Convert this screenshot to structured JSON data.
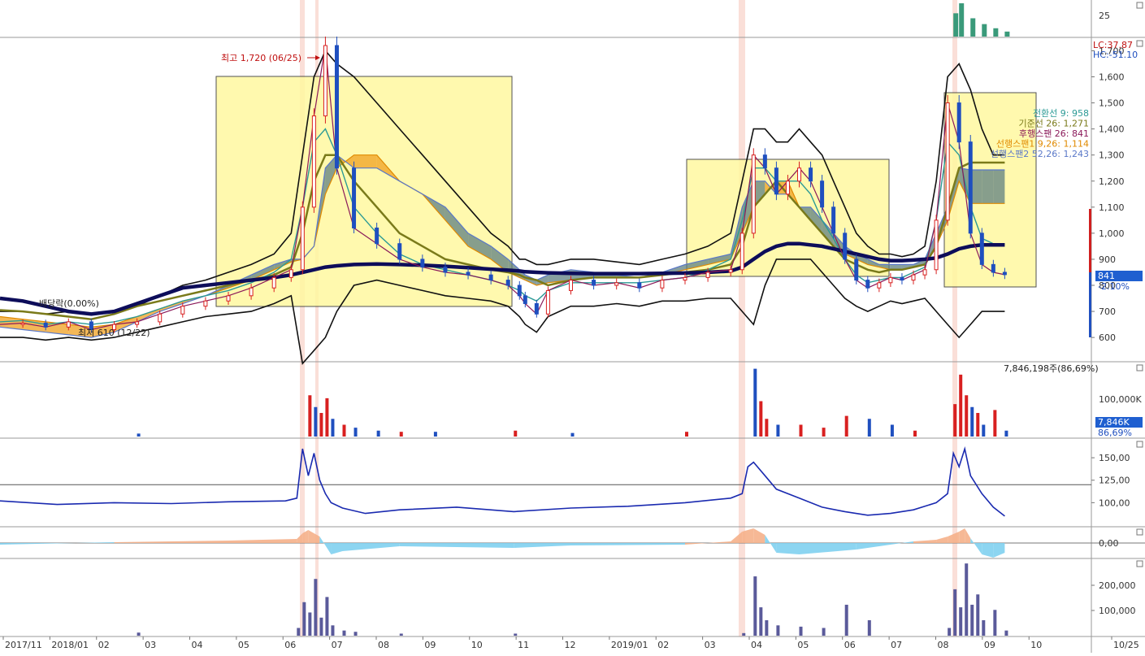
{
  "chart_data": {
    "type": "line",
    "x_ticks": [
      "2017/11",
      "2018/01",
      "02",
      "03",
      "04",
      "05",
      "06",
      "07",
      "08",
      "09",
      "10",
      "11",
      "12",
      "2019/01",
      "02",
      "03",
      "04",
      "05",
      "06",
      "07",
      "08",
      "09",
      "10",
      "10/25"
    ],
    "top_panel": {
      "axis_label": "25",
      "x": [
        0.835,
        0.84,
        0.85,
        0.86,
        0.87,
        0.88
      ],
      "values": [
        28,
        40,
        22,
        15,
        10,
        6
      ]
    },
    "price_panel": {
      "y_ticks": [
        1700,
        1600,
        1500,
        1400,
        1300,
        1200,
        1100,
        1000,
        900,
        800,
        700,
        600
      ],
      "ylim": [
        510,
        1745
      ],
      "lc_label": "LC:37.87",
      "hc_label": "HC:-51.10",
      "current_price_label": "841",
      "current_change_label": "-2.10%",
      "high_label": "최고 1,720 (06/25)",
      "low_label": "최저 610 (12/22)",
      "dividend_label": "배당락(0.00%)",
      "legend": [
        {
          "text": "전환선 9: 958",
          "color": "#2b9a95"
        },
        {
          "text": "기준선 26: 1,271",
          "color": "#7a7a1a"
        },
        {
          "text": "후행스팬 26: 841",
          "color": "#8b1a5a"
        },
        {
          "text": "선행스팬1 9,26: 1,114",
          "color": "#e08a00"
        },
        {
          "text": "선행스팬2 52,26: 1,243",
          "color": "#5a78c8"
        }
      ],
      "x": [
        0.0,
        0.02,
        0.04,
        0.06,
        0.08,
        0.1,
        0.12,
        0.14,
        0.16,
        0.18,
        0.2,
        0.22,
        0.24,
        0.255,
        0.265,
        0.275,
        0.285,
        0.295,
        0.31,
        0.33,
        0.35,
        0.37,
        0.39,
        0.41,
        0.43,
        0.445,
        0.455,
        0.46,
        0.47,
        0.48,
        0.5,
        0.52,
        0.54,
        0.56,
        0.58,
        0.6,
        0.62,
        0.64,
        0.65,
        0.66,
        0.67,
        0.68,
        0.69,
        0.7,
        0.71,
        0.72,
        0.73,
        0.74,
        0.75,
        0.76,
        0.77,
        0.78,
        0.79,
        0.8,
        0.81,
        0.82,
        0.83,
        0.84,
        0.85,
        0.86,
        0.87,
        0.88
      ],
      "close": [
        650,
        655,
        640,
        660,
        630,
        650,
        660,
        690,
        720,
        740,
        760,
        790,
        830,
        860,
        1100,
        1450,
        1720,
        1250,
        1020,
        960,
        900,
        870,
        850,
        840,
        820,
        800,
        760,
        730,
        690,
        780,
        820,
        800,
        810,
        790,
        820,
        830,
        850,
        860,
        1000,
        1300,
        1250,
        1150,
        1200,
        1250,
        1200,
        1100,
        1000,
        900,
        820,
        790,
        810,
        830,
        820,
        840,
        860,
        1050,
        1500,
        1350,
        1000,
        880,
        850,
        841
      ],
      "kijun": [
        705,
        700,
        690,
        680,
        670,
        690,
        720,
        740,
        760,
        780,
        800,
        820,
        840,
        870,
        1000,
        1200,
        1300,
        1300,
        1200,
        1100,
        1000,
        950,
        900,
        880,
        860,
        850,
        840,
        830,
        820,
        800,
        820,
        830,
        830,
        830,
        840,
        850,
        860,
        880,
        950,
        1100,
        1150,
        1200,
        1150,
        1100,
        1050,
        1000,
        950,
        900,
        880,
        860,
        850,
        860,
        860,
        870,
        880,
        950,
        1100,
        1250,
        1271,
        1271,
        1271,
        1271
      ],
      "tenkan": [
        660,
        665,
        650,
        660,
        650,
        660,
        680,
        710,
        740,
        760,
        780,
        810,
        850,
        900,
        1100,
        1350,
        1400,
        1300,
        1100,
        1000,
        920,
        880,
        860,
        840,
        820,
        800,
        780,
        760,
        740,
        780,
        810,
        810,
        810,
        810,
        820,
        830,
        860,
        900,
        1050,
        1250,
        1250,
        1200,
        1200,
        1200,
        1150,
        1050,
        980,
        900,
        840,
        810,
        820,
        830,
        830,
        850,
        870,
        1050,
        1350,
        1300,
        1100,
        980,
        960,
        958
      ],
      "ma_long": [
        750,
        740,
        720,
        700,
        690,
        700,
        730,
        760,
        790,
        800,
        810,
        820,
        830,
        840,
        850,
        860,
        870,
        875,
        880,
        882,
        880,
        877,
        873,
        868,
        862,
        858,
        855,
        852,
        850,
        848,
        846,
        845,
        845,
        845,
        846,
        847,
        850,
        855,
        870,
        900,
        930,
        950,
        960,
        960,
        955,
        950,
        940,
        930,
        920,
        910,
        900,
        895,
        895,
        897,
        900,
        905,
        920,
        940,
        950,
        955,
        955,
        955
      ],
      "span2": [
        640,
        630,
        620,
        610,
        600,
        620,
        660,
        700,
        730,
        760,
        800,
        840,
        880,
        900,
        900,
        950,
        1250,
        1300,
        1250,
        1250,
        1200,
        1150,
        1100,
        1000,
        950,
        900,
        860,
        840,
        820,
        840,
        860,
        850,
        840,
        830,
        850,
        880,
        900,
        920,
        1100,
        1200,
        1200,
        1150,
        1150,
        1100,
        1100,
        1050,
        1000,
        950,
        920,
        900,
        880,
        880,
        880,
        880,
        900,
        1000,
        1100,
        1250,
        1243,
        1243,
        1243,
        1243
      ],
      "span1": [
        680,
        670,
        660,
        650,
        640,
        650,
        680,
        710,
        740,
        760,
        790,
        820,
        860,
        890,
        900,
        950,
        1150,
        1250,
        1300,
        1300,
        1200,
        1150,
        1050,
        950,
        900,
        850,
        830,
        820,
        800,
        810,
        820,
        830,
        830,
        830,
        840,
        860,
        880,
        900,
        1000,
        1100,
        1150,
        1200,
        1200,
        1100,
        1050,
        1000,
        950,
        920,
        900,
        880,
        870,
        860,
        860,
        870,
        880,
        950,
        1050,
        1200,
        1114,
        1114,
        1114,
        1114
      ],
      "boll_upper": [
        700,
        700,
        690,
        700,
        690,
        700,
        720,
        760,
        800,
        820,
        850,
        880,
        920,
        1000,
        1300,
        1600,
        1700,
        1650,
        1600,
        1500,
        1400,
        1300,
        1200,
        1100,
        1000,
        950,
        900,
        900,
        880,
        880,
        900,
        900,
        890,
        880,
        900,
        920,
        950,
        1000,
        1200,
        1400,
        1400,
        1350,
        1350,
        1400,
        1350,
        1300,
        1200,
        1100,
        1000,
        950,
        920,
        920,
        910,
        920,
        950,
        1200,
        1600,
        1650,
        1550,
        1400,
        1300,
        1300
      ],
      "boll_lower": [
        600,
        600,
        590,
        600,
        590,
        600,
        620,
        640,
        660,
        680,
        690,
        700,
        730,
        760,
        500,
        550,
        600,
        700,
        800,
        820,
        800,
        780,
        760,
        750,
        740,
        720,
        680,
        650,
        620,
        680,
        720,
        720,
        730,
        720,
        740,
        740,
        750,
        750,
        700,
        650,
        800,
        900,
        900,
        900,
        900,
        850,
        800,
        750,
        720,
        700,
        720,
        740,
        730,
        740,
        750,
        700,
        650,
        600,
        650,
        700,
        700,
        700
      ]
    },
    "volume_panel": {
      "max_label": "7,846,198주(86,69%)",
      "y_ticks": [
        "100,000K"
      ],
      "current_label": "7,846K",
      "current_pct_label": "86,69%",
      "x": [
        0.12,
        0.27,
        0.275,
        0.28,
        0.285,
        0.29,
        0.3,
        0.31,
        0.33,
        0.35,
        0.38,
        0.45,
        0.5,
        0.6,
        0.66,
        0.665,
        0.67,
        0.68,
        0.7,
        0.72,
        0.74,
        0.76,
        0.78,
        0.8,
        0.835,
        0.84,
        0.845,
        0.85,
        0.855,
        0.86,
        0.87,
        0.88
      ],
      "values": [
        5,
        70,
        50,
        40,
        65,
        30,
        20,
        15,
        10,
        8,
        8,
        10,
        6,
        8,
        115,
        60,
        30,
        20,
        20,
        15,
        35,
        30,
        20,
        10,
        55,
        105,
        70,
        50,
        40,
        20,
        45,
        10
      ],
      "colors": [
        "#1f4fbf",
        "#d82020",
        "#1f4fbf",
        "#d82020",
        "#d82020",
        "#1f4fbf",
        "#d82020",
        "#1f4fbf",
        "#1f4fbf",
        "#d82020",
        "#1f4fbf",
        "#d82020",
        "#1f4fbf",
        "#d82020",
        "#1f4fbf",
        "#d82020",
        "#d82020",
        "#1f4fbf",
        "#d82020",
        "#d82020",
        "#d82020",
        "#1f4fbf",
        "#1f4fbf",
        "#d82020",
        "#d82020",
        "#d82020",
        "#d82020",
        "#1f4fbf",
        "#d82020",
        "#1f4fbf",
        "#d82020",
        "#1f4fbf"
      ]
    },
    "indicator_panel": {
      "y_ticks": [
        150,
        125,
        100
      ],
      "ref_line": 120,
      "x": [
        0.0,
        0.05,
        0.1,
        0.15,
        0.2,
        0.25,
        0.26,
        0.265,
        0.27,
        0.275,
        0.28,
        0.285,
        0.29,
        0.3,
        0.32,
        0.35,
        0.4,
        0.45,
        0.5,
        0.55,
        0.6,
        0.64,
        0.65,
        0.655,
        0.66,
        0.67,
        0.68,
        0.7,
        0.72,
        0.74,
        0.76,
        0.78,
        0.8,
        0.82,
        0.83,
        0.835,
        0.84,
        0.845,
        0.85,
        0.86,
        0.87,
        0.88
      ],
      "values": [
        102,
        98,
        100,
        99,
        101,
        102,
        105,
        160,
        130,
        155,
        125,
        110,
        100,
        94,
        88,
        92,
        95,
        90,
        94,
        96,
        100,
        105,
        110,
        140,
        145,
        130,
        115,
        105,
        95,
        90,
        86,
        88,
        92,
        100,
        110,
        155,
        140,
        160,
        130,
        110,
        95,
        85
      ]
    },
    "osc_panel": {
      "zero_label": "0,00",
      "x": [
        0.0,
        0.1,
        0.2,
        0.26,
        0.265,
        0.27,
        0.28,
        0.29,
        0.3,
        0.35,
        0.4,
        0.45,
        0.5,
        0.6,
        0.64,
        0.65,
        0.66,
        0.67,
        0.68,
        0.7,
        0.75,
        0.8,
        0.82,
        0.83,
        0.84,
        0.845,
        0.85,
        0.86,
        0.87,
        0.88
      ],
      "values": [
        -2,
        1,
        3,
        5,
        12,
        16,
        8,
        -14,
        -10,
        -4,
        -5,
        -6,
        -3,
        -2,
        2,
        14,
        18,
        10,
        -12,
        -14,
        -8,
        2,
        4,
        8,
        14,
        18,
        6,
        -14,
        -18,
        -12
      ]
    },
    "bottom_volume_panel": {
      "y_ticks": [
        "200,000",
        "100,000"
      ],
      "x": [
        0.12,
        0.26,
        0.265,
        0.27,
        0.275,
        0.28,
        0.285,
        0.29,
        0.3,
        0.31,
        0.35,
        0.45,
        0.65,
        0.66,
        0.665,
        0.67,
        0.68,
        0.7,
        0.72,
        0.74,
        0.76,
        0.83,
        0.835,
        0.84,
        0.845,
        0.85,
        0.855,
        0.86,
        0.87,
        0.88
      ],
      "values": [
        12,
        30,
        130,
        90,
        220,
        70,
        150,
        40,
        20,
        15,
        8,
        8,
        10,
        230,
        110,
        60,
        40,
        35,
        30,
        120,
        60,
        30,
        180,
        110,
        280,
        120,
        160,
        60,
        100,
        20
      ]
    }
  }
}
